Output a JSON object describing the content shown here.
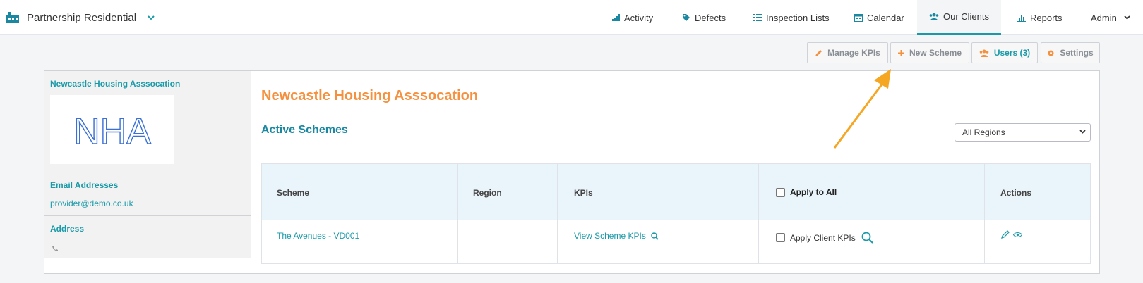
{
  "header": {
    "brand_name": "Partnership Residential",
    "nav": [
      {
        "label": "Activity",
        "icon": "bar-chart-icon"
      },
      {
        "label": "Defects",
        "icon": "tag-icon"
      },
      {
        "label": "Inspection Lists",
        "icon": "list-icon"
      },
      {
        "label": "Calendar",
        "icon": "calendar-icon"
      },
      {
        "label": "Our Clients",
        "icon": "users-icon",
        "active": true
      },
      {
        "label": "Reports",
        "icon": "report-chart-icon"
      },
      {
        "label": "Admin",
        "icon": "chevron-down-icon"
      }
    ]
  },
  "toolbar": {
    "manage_kpis": "Manage KPIs",
    "new_scheme": "New Scheme",
    "users": "Users (3)",
    "settings": "Settings"
  },
  "client": {
    "name": "Newcastle Housing Asssocation",
    "logo_text": "NHA",
    "email_label": "Email Addresses",
    "email": "provider@demo.co.uk",
    "address_label": "Address"
  },
  "main": {
    "title": "Newcastle Housing Asssocation",
    "section_title": "Active Schemes",
    "region_filter": "All Regions"
  },
  "table": {
    "headers": [
      "Scheme",
      "Region",
      "KPIs",
      "Apply to All",
      "Actions"
    ],
    "rows": [
      {
        "scheme": "The Avenues - VD001",
        "region": "",
        "kpis": "View Scheme KPIs",
        "apply": "Apply Client KPIs"
      }
    ]
  },
  "colors": {
    "accent": "#1a9aa8",
    "orange": "#f5913e"
  }
}
